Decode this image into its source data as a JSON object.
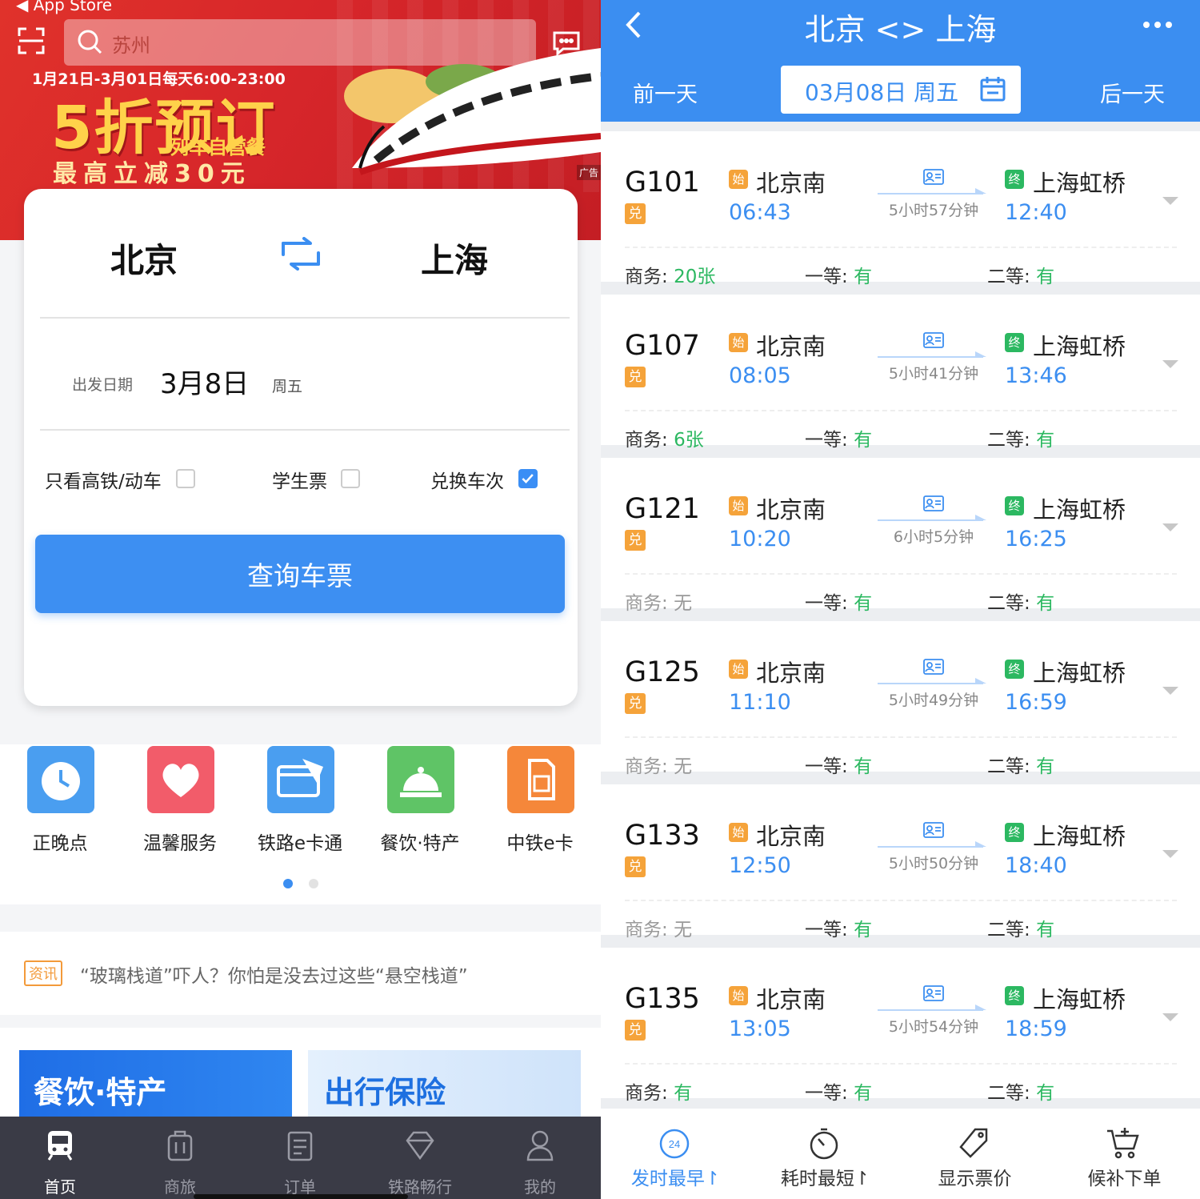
{
  "left": {
    "status": {
      "back_app": "App Store"
    },
    "search": {
      "placeholder": "苏州"
    },
    "banner": {
      "date_range": "1月21日-3月01日每天6:00-23:00",
      "headline": "5折预订",
      "subline": "列车自营餐",
      "offer": "最高立减30元",
      "ad_tag": "广告"
    },
    "query": {
      "from": "北京",
      "to": "上海",
      "date_label": "出发日期",
      "date_value": "3月8日",
      "weekday": "周五",
      "options": [
        {
          "label": "只看高铁/动车",
          "checked": false
        },
        {
          "label": "学生票",
          "checked": false
        },
        {
          "label": "兑换车次",
          "checked": true
        }
      ],
      "search_button": "查询车票"
    },
    "services": [
      {
        "label": "正晚点",
        "icon": "clock-icon",
        "color": "#4a9ef0"
      },
      {
        "label": "温馨服务",
        "icon": "heart-icon",
        "color": "#f25c6a"
      },
      {
        "label": "铁路e卡通",
        "icon": "card-icon",
        "color": "#4a9ef0"
      },
      {
        "label": "餐饮·特产",
        "icon": "dining-bell-icon",
        "color": "#5fc466"
      },
      {
        "label": "中铁e卡",
        "icon": "sim-card-icon",
        "color": "#f5873a"
      }
    ],
    "pager": {
      "active": 0,
      "count": 2
    },
    "news": {
      "tag": "资讯",
      "text": "“玻璃栈道”吓人？你怕是没去过这些“悬空栈道”"
    },
    "promo_cards": [
      {
        "label": "餐饮·特产"
      },
      {
        "label": "出行保险"
      }
    ],
    "tabs": [
      {
        "label": "首页",
        "icon": "train-icon",
        "active": true
      },
      {
        "label": "商旅",
        "icon": "luggage-icon",
        "active": false
      },
      {
        "label": "订单",
        "icon": "order-list-icon",
        "active": false
      },
      {
        "label": "铁路畅行",
        "icon": "diamond-icon",
        "active": false
      },
      {
        "label": "我的",
        "icon": "user-icon",
        "active": false
      }
    ]
  },
  "right": {
    "title": "北京 <> 上海",
    "prev_day": "前一天",
    "next_day": "后一天",
    "date": "03月08日 周五",
    "colors": {
      "primary": "#3b8ef1",
      "available": "#2cb861",
      "origin_badge": "#f5a33a",
      "terminal_badge": "#2cb861"
    },
    "start_badge": "始",
    "end_badge": "终",
    "exchange_badge": "兑",
    "trains": [
      {
        "no": "G101",
        "from": "北京南",
        "to": "上海虹桥",
        "dep": "06:43",
        "arr": "12:40",
        "duration": "5小时57分钟",
        "seats": [
          {
            "label": "商务: ",
            "value": "20张"
          },
          {
            "label": "一等: ",
            "value": "有"
          },
          {
            "label": "二等: ",
            "value": "有"
          }
        ]
      },
      {
        "no": "G107",
        "from": "北京南",
        "to": "上海虹桥",
        "dep": "08:05",
        "arr": "13:46",
        "duration": "5小时41分钟",
        "seats": [
          {
            "label": "商务: ",
            "value": "6张"
          },
          {
            "label": "一等: ",
            "value": "有"
          },
          {
            "label": "二等: ",
            "value": "有"
          }
        ]
      },
      {
        "no": "G121",
        "from": "北京南",
        "to": "上海虹桥",
        "dep": "10:20",
        "arr": "16:25",
        "duration": "6小时5分钟",
        "seats": [
          {
            "label": "商务: ",
            "value": "无"
          },
          {
            "label": "一等: ",
            "value": "有"
          },
          {
            "label": "二等: ",
            "value": "有"
          }
        ]
      },
      {
        "no": "G125",
        "from": "北京南",
        "to": "上海虹桥",
        "dep": "11:10",
        "arr": "16:59",
        "duration": "5小时49分钟",
        "seats": [
          {
            "label": "商务: ",
            "value": "无"
          },
          {
            "label": "一等: ",
            "value": "有"
          },
          {
            "label": "二等: ",
            "value": "有"
          }
        ]
      },
      {
        "no": "G133",
        "from": "北京南",
        "to": "上海虹桥",
        "dep": "12:50",
        "arr": "18:40",
        "duration": "5小时50分钟",
        "seats": [
          {
            "label": "商务: ",
            "value": "无"
          },
          {
            "label": "一等: ",
            "value": "有"
          },
          {
            "label": "二等: ",
            "value": "有"
          }
        ]
      },
      {
        "no": "G135",
        "from": "北京南",
        "to": "上海虹桥",
        "dep": "13:05",
        "arr": "18:59",
        "duration": "5小时54分钟",
        "seats": [
          {
            "label": "商务: ",
            "value": "有"
          },
          {
            "label": "一等: ",
            "value": "有"
          },
          {
            "label": "二等: ",
            "value": "有"
          }
        ]
      }
    ],
    "bottom": [
      {
        "label": "发时最早↾",
        "icon": "24h-clock-icon",
        "icon_text": "24",
        "active": true
      },
      {
        "label": "耗时最短↾",
        "icon": "timer-icon",
        "active": false
      },
      {
        "label": "显示票价",
        "icon": "price-tag-icon",
        "active": false
      },
      {
        "label": "候补下单",
        "icon": "cart-icon",
        "active": false
      }
    ]
  }
}
